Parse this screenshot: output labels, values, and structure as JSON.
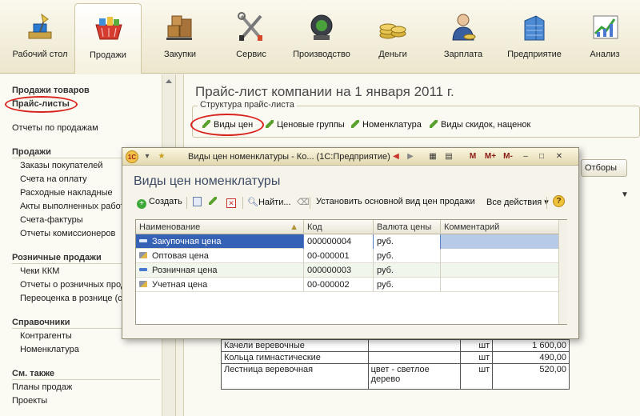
{
  "toolbar": {
    "items": [
      {
        "label": "Рабочий стол",
        "icon": "desktop-lamp-icon",
        "active": false
      },
      {
        "label": "Продажи",
        "icon": "shopping-basket-icon",
        "active": true
      },
      {
        "label": "Закупки",
        "icon": "boxes-cart-icon",
        "active": false
      },
      {
        "label": "Сервис",
        "icon": "tools-icon",
        "active": false
      },
      {
        "label": "Производство",
        "icon": "factory-icon",
        "active": false
      },
      {
        "label": "Деньги",
        "icon": "coins-icon",
        "active": false
      },
      {
        "label": "Зарплата",
        "icon": "employee-icon",
        "active": false
      },
      {
        "label": "Предприятие",
        "icon": "building-icon",
        "active": false
      },
      {
        "label": "Анализ",
        "icon": "chart-icon",
        "active": false
      }
    ]
  },
  "sidebar": {
    "top_links": [
      "Продажи товаров",
      "Прайс-листы",
      "Отчеты по продажам"
    ],
    "sections": [
      {
        "title": "Продажи",
        "items": [
          "Заказы покупателей",
          "Счета на оплату",
          "Расходные накладные",
          "Акты выполненных работ",
          "Счета-фактуры",
          "Отчеты комиссионеров"
        ]
      },
      {
        "title": "Розничные продажи",
        "items": [
          "Чеки ККМ",
          "Отчеты о розничных продажах",
          "Переоценка в рознице (суммовой учет)"
        ]
      },
      {
        "title": "Справочники",
        "items": [
          "Контрагенты",
          "Номенклатура"
        ]
      },
      {
        "title": "См. также",
        "items": [
          "Планы продаж",
          "Проекты"
        ]
      }
    ]
  },
  "main": {
    "title": "Прайс-лист компании на 1 января 2011 г.",
    "structure_caption": "Структура прайс-листа",
    "structure_items": [
      "Виды цен",
      "Ценовые группы",
      "Номенклатура",
      "Виды скидок, наценок"
    ],
    "reports_button": "Отборы",
    "table_rows": [
      {
        "name": "Качели веревочные",
        "desc": "",
        "unit": "шт",
        "price": "1 600,00"
      },
      {
        "name": "Кольца гимнастические",
        "desc": "",
        "unit": "шт",
        "price": "490,00"
      },
      {
        "name": "Лестница веревочная",
        "desc": "цвет - светлое дерево",
        "unit": "шт",
        "price": "520,00"
      }
    ]
  },
  "dialog": {
    "title": "Виды цен номенклатуры - Ко... (1С:Предприятие)",
    "heading": "Виды цен номенклатуры",
    "toolbar": {
      "create": "Создать",
      "find": "Найти...",
      "set_default": "Установить основной вид цен продажи",
      "all_actions": "Все действия",
      "help": "?"
    },
    "window_controls": [
      "M",
      "M+",
      "M-"
    ],
    "columns": [
      "Наименование",
      "Код",
      "Валюта цены",
      "Комментарий"
    ],
    "rows": [
      {
        "name": "Закупочная цена",
        "code": "000000004",
        "currency": "руб.",
        "comment": "",
        "icon": "price-type-icon"
      },
      {
        "name": "Оптовая цена",
        "code": "00-000001",
        "currency": "руб.",
        "comment": "",
        "icon": "price-type-edit-icon"
      },
      {
        "name": "Розничная цена",
        "code": "000000003",
        "currency": "руб.",
        "comment": "",
        "icon": "price-type-icon"
      },
      {
        "name": "Учетная цена",
        "code": "00-000002",
        "currency": "руб.",
        "comment": "",
        "icon": "price-type-edit-icon"
      }
    ]
  },
  "colors": {
    "selection": "#3662b6",
    "highlight_oval": "#d9231d",
    "heading_blue": "#3e4b66"
  }
}
